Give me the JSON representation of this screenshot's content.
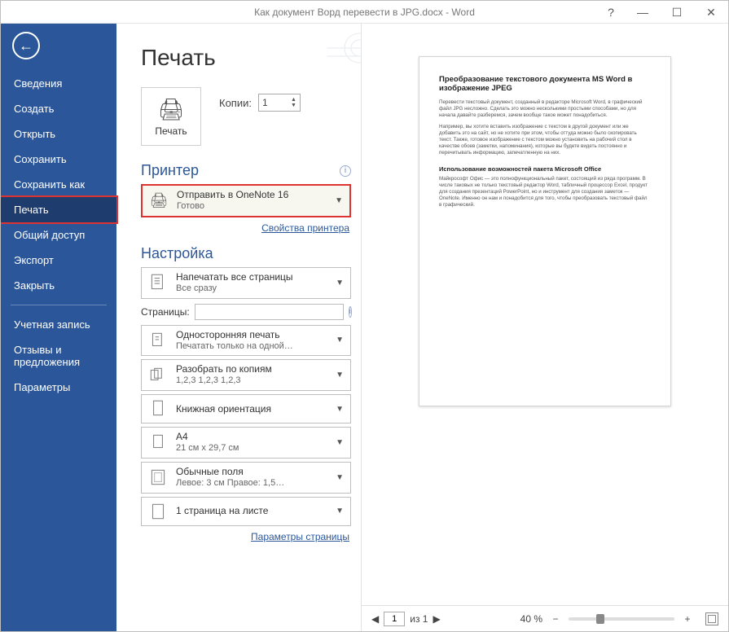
{
  "window_title": "Как документ Ворд перевести в JPG.docx - Word",
  "sidebar": {
    "items": [
      "Сведения",
      "Создать",
      "Открыть",
      "Сохранить",
      "Сохранить как",
      "Печать",
      "Общий доступ",
      "Экспорт",
      "Закрыть"
    ],
    "items2": [
      "Учетная запись",
      "Отзывы и предложения",
      "Параметры"
    ],
    "selected": "Печать"
  },
  "page_heading": "Печать",
  "print_button": "Печать",
  "copies": {
    "label": "Копии:",
    "value": "1"
  },
  "printer": {
    "heading": "Принтер",
    "name": "Отправить в OneNote 16",
    "status": "Готово",
    "link": "Свойства принтера"
  },
  "settings": {
    "heading": "Настройка",
    "print_what": {
      "title": "Напечатать все страницы",
      "sub": "Все сразу"
    },
    "pages_label": "Страницы:",
    "sides": {
      "title": "Односторонняя печать",
      "sub": "Печатать только на одной…"
    },
    "collate": {
      "title": "Разобрать по копиям",
      "sub": "1,2,3    1,2,3    1,2,3"
    },
    "orient": {
      "title": "Книжная ориентация",
      "sub": ""
    },
    "paper": {
      "title": "A4",
      "sub": "21 см x 29,7 см"
    },
    "margins": {
      "title": "Обычные поля",
      "sub": "Левое: 3 см   Правое: 1,5…"
    },
    "perpage": {
      "title": "1 страница на листе",
      "sub": ""
    },
    "page_setup_link": "Параметры страницы"
  },
  "preview": {
    "doc_title": "Преобразование текстового документа MS Word в изображение JPEG",
    "p1": "Перевести текстовый документ, созданный в редакторе Microsoft Word, в графический файл JPG несложно. Сделать это можно несколькими простыми способами, но для начала давайте разберемся, зачем вообще такое может понадобиться.",
    "p2": "Например, вы хотите вставить изображение с текстом в другой документ или же добавить это на сайт, но не хотите при этом, чтобы оттуда можно было скопировать текст. Также, готовое изображение с текстом можно установить на рабочий стол в качестве обоев (заметки, напоминания), которые вы будете видеть постоянно и перечитывать информацию, запечатленную на них.",
    "h2": "Использование возможностей пакета Microsoft Office",
    "p3": "Майкрософт Офис — это полнофункциональный пакет, состоящий из ряда программ. В числе таковых не только текстовый редактор Word, табличный процессор Excel, продукт для создания презентаций PowerPoint, но и инструмент для создания заметок — OneNote. Именно он нам и понадобится для того, чтобы преобразовать текстовый файл в графический.",
    "footer": {
      "page_value": "1",
      "page_of": "из 1",
      "zoom": "40 %"
    }
  }
}
